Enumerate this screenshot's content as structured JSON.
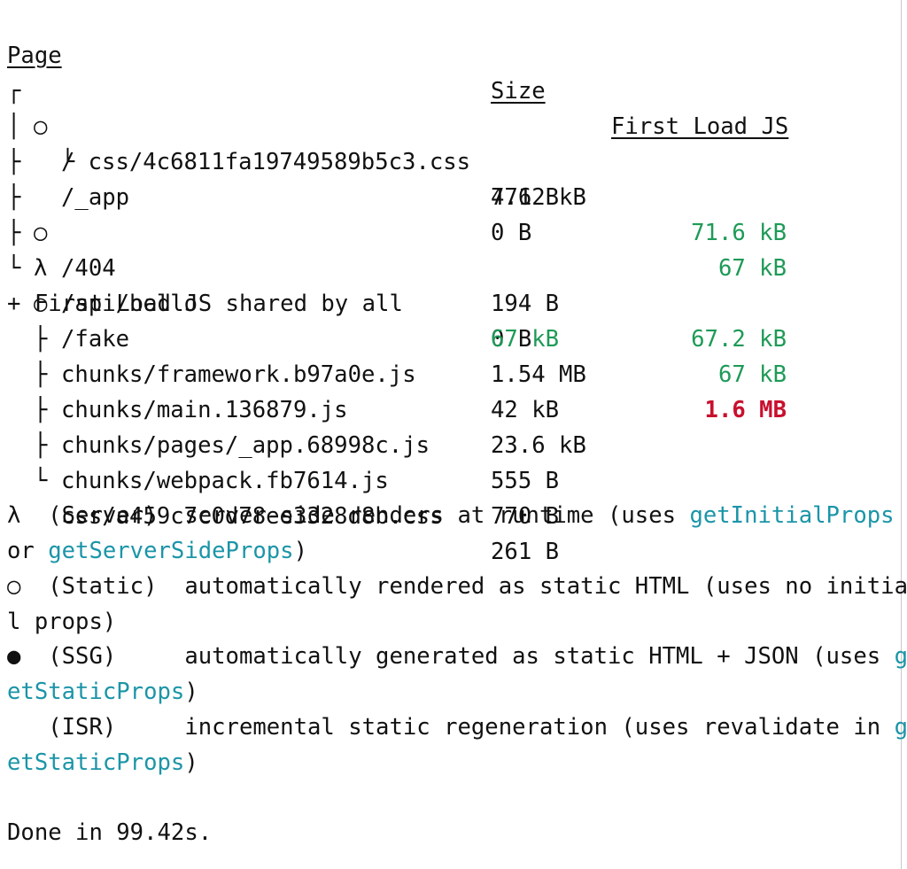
{
  "header": {
    "page": "Page",
    "size": "Size",
    "first_load": "First Load JS"
  },
  "routes": [
    {
      "tree": "┌",
      "icon": "○",
      "path": "/",
      "size": "4.62 kB",
      "first_load": "71.6 kB",
      "first_load_status": "ok"
    },
    {
      "tree": "│",
      "icon": "",
      "path": "  └ css/4c6811fa19749589b5c3.css",
      "size": "771 B",
      "first_load": "",
      "first_load_status": "none"
    },
    {
      "tree": "├",
      "icon": "",
      "path": "/_app",
      "size": "0 B",
      "first_load": "67 kB",
      "first_load_status": "ok"
    },
    {
      "tree": "├",
      "icon": "○",
      "path": "/404",
      "size": "194 B",
      "first_load": "67.2 kB",
      "first_load_status": "ok"
    },
    {
      "tree": "├",
      "icon": "λ",
      "path": "/api/hello",
      "size": "0 B",
      "first_load": "67 kB",
      "first_load_status": "ok"
    },
    {
      "tree": "└",
      "icon": "○",
      "path": "/fake",
      "size": "1.54 MB",
      "first_load": "1.6 MB",
      "first_load_status": "warning"
    }
  ],
  "shared": {
    "label": "+ First Load JS shared by all",
    "size": "67 kB",
    "chunks": [
      {
        "tree": "├",
        "name": "chunks/framework.b97a0e.js",
        "size": "42 kB"
      },
      {
        "tree": "├",
        "name": "chunks/main.136879.js",
        "size": "23.6 kB"
      },
      {
        "tree": "├",
        "name": "chunks/pages/_app.68998c.js",
        "size": "555 B"
      },
      {
        "tree": "├",
        "name": "chunks/webpack.fb7614.js",
        "size": "770 B"
      },
      {
        "tree": "└",
        "name": "css/a459c7c0d78ee3328d8b.css",
        "size": "261 B"
      }
    ]
  },
  "legend": {
    "server_line1_a": "λ  (Server)  server-side renders at runtime (uses ",
    "server_line1_b": "getInitialProps",
    "server_line2_a": "or ",
    "server_line2_b": "getServerSideProps",
    "server_line2_c": ")",
    "static_line1": "○  (Static)  automatically rendered as static HTML (uses no initia",
    "static_line2": "l props)",
    "ssg_line1_a": "●  (SSG)     automatically generated as static HTML + JSON (uses ",
    "ssg_line1_b": "g",
    "ssg_line2_a": "etStaticProps",
    "ssg_line2_b": ")",
    "isr_line1_a": "   (ISR)     incremental static regeneration (uses revalidate in ",
    "isr_line1_b": "g",
    "isr_line2_a": "etStaticProps",
    "isr_line2_b": ")"
  },
  "done": "Done in 99.42s.",
  "colors": {
    "ok": "#1e9a57",
    "warning": "#c8102e",
    "function": "#1b95a8",
    "text": "#111111"
  }
}
